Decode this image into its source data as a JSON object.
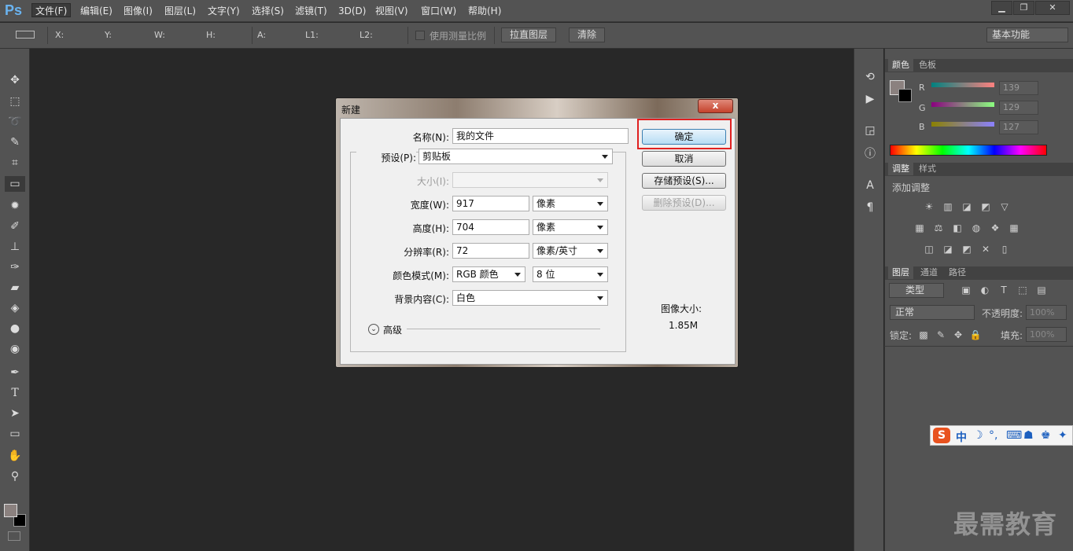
{
  "app": {
    "logo": "Ps"
  },
  "menu": [
    {
      "label": "文件(F)",
      "active": true
    },
    {
      "label": "编辑(E)"
    },
    {
      "label": "图像(I)"
    },
    {
      "label": "图层(L)"
    },
    {
      "label": "文字(Y)"
    },
    {
      "label": "选择(S)"
    },
    {
      "label": "滤镜(T)"
    },
    {
      "label": "3D(D)"
    },
    {
      "label": "视图(V)"
    },
    {
      "label": "窗口(W)"
    },
    {
      "label": "帮助(H)"
    }
  ],
  "window_buttons": {
    "minimize": "▁",
    "restore": "❐",
    "close": "✕"
  },
  "options_bar": {
    "x": "X:",
    "y": "Y:",
    "w": "W:",
    "h": "H:",
    "a": "A:",
    "l1": "L1:",
    "l2": "L2:",
    "use_scale": "使用测量比例",
    "straighten": "拉直图层",
    "clear": "清除",
    "workspace": "基本功能"
  },
  "panels": {
    "color_tabs": [
      "颜色",
      "色板"
    ],
    "rgb": [
      {
        "channel": "R",
        "value": "139"
      },
      {
        "channel": "G",
        "value": "129"
      },
      {
        "channel": "B",
        "value": "127"
      }
    ],
    "adjust_tabs": [
      "调整",
      "样式"
    ],
    "add_adjustment": "添加调整",
    "layers_tabs": [
      "图层",
      "通道",
      "路径"
    ],
    "filter_kind": "类型",
    "blend_mode": "正常",
    "opacity_label": "不透明度:",
    "opacity_value": "100%",
    "lock_label": "锁定:",
    "fill_label": "填充:",
    "fill_value": "100%"
  },
  "ime": {
    "label": "中",
    "logo": "S"
  },
  "watermark": "最需教育",
  "dialog": {
    "title": "新建",
    "close": "x",
    "name_label": "名称(N):",
    "name_value": "我的文件",
    "preset_label": "预设(P):",
    "preset_value": "剪贴板",
    "size_label": "大小(I):",
    "width_label": "宽度(W):",
    "width_value": "917",
    "width_unit": "像素",
    "height_label": "高度(H):",
    "height_value": "704",
    "height_unit": "像素",
    "resolution_label": "分辨率(R):",
    "resolution_value": "72",
    "resolution_unit": "像素/英寸",
    "color_mode_label": "颜色模式(M):",
    "color_mode_value": "RGB 颜色",
    "bit_depth": "8 位",
    "background_label": "背景内容(C):",
    "background_value": "白色",
    "advanced": "高级",
    "ok": "确定",
    "cancel": "取消",
    "save_preset": "存储预设(S)...",
    "delete_preset": "删除预设(D)...",
    "image_size_label": "图像大小:",
    "image_size_value": "1.85M"
  },
  "colors": {
    "accent": "#3c7fb1",
    "highlight": "#e02020",
    "fg_swatch": "#8b817f"
  }
}
